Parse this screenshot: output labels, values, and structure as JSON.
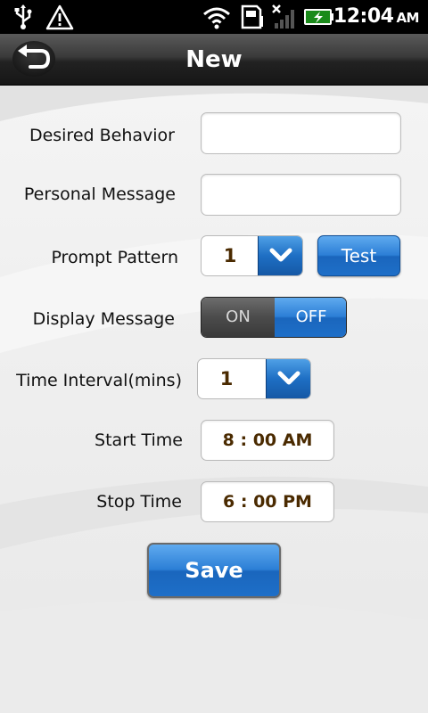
{
  "status_bar": {
    "time": "12:04",
    "ampm": "AM",
    "icons": [
      "usb-icon",
      "warning-icon",
      "wifi-icon",
      "sd-card-icon",
      "no-signal-icon",
      "battery-charging-icon"
    ]
  },
  "title_bar": {
    "title": "New",
    "back_icon": "back-arrow-icon"
  },
  "form": {
    "desired_behavior": {
      "label": "Desired Behavior",
      "value": ""
    },
    "personal_message": {
      "label": "Personal Message",
      "value": ""
    },
    "prompt_pattern": {
      "label": "Prompt Pattern",
      "value": "1",
      "test_label": "Test"
    },
    "display_message": {
      "label": "Display Message",
      "on_label": "ON",
      "off_label": "OFF",
      "selected": "OFF"
    },
    "time_interval": {
      "label": "Time Interval(mins)",
      "value": "1"
    },
    "start_time": {
      "label": "Start Time",
      "value": "8 : 00 AM"
    },
    "stop_time": {
      "label": "Stop Time",
      "value": "6 : 00 PM"
    },
    "save_label": "Save"
  },
  "colors": {
    "accent": "#1e6fc8",
    "value_text": "#4a2a00",
    "toggle_off_bg": "#4b4b4b"
  }
}
